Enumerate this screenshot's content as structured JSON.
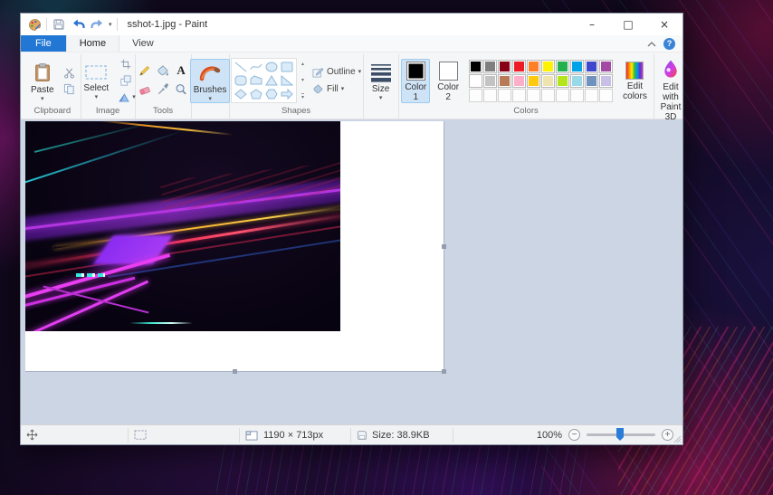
{
  "titlebar": {
    "title": "sshot-1.jpg - Paint",
    "minimize": "–",
    "maximize": "□",
    "close": "×"
  },
  "tabs": {
    "file": "File",
    "home": "Home",
    "view": "View"
  },
  "ribbon": {
    "clipboard": {
      "label": "Clipboard",
      "paste": "Paste"
    },
    "image": {
      "label": "Image",
      "select": "Select"
    },
    "tools": {
      "label": "Tools",
      "text_icon": "A"
    },
    "brushes": {
      "label": "Brushes"
    },
    "shapes": {
      "label": "Shapes",
      "outline": "Outline",
      "fill": "Fill"
    },
    "size": {
      "label": "Size"
    },
    "colors": {
      "label": "Colors",
      "color1_top": "Color",
      "color1_bottom": "1",
      "color2_top": "Color",
      "color2_bottom": "2",
      "edit_top": "Edit",
      "edit_bottom": "colors",
      "color1_value": "#000000",
      "color2_value": "#ffffff",
      "palette": [
        [
          "#000000",
          "#7f7f7f",
          "#880015",
          "#ed1c24",
          "#ff7f27",
          "#fff200",
          "#22b14c",
          "#00a2e8",
          "#3f48cc",
          "#a349a4"
        ],
        [
          "#ffffff",
          "#c3c3c3",
          "#b97a57",
          "#ffaec9",
          "#ffc90e",
          "#efe4b0",
          "#b5e61d",
          "#99d9ea",
          "#7092be",
          "#c8bfe7"
        ]
      ],
      "empty_slots": 10
    },
    "paint3d": {
      "line1": "Edit with",
      "line2": "Paint 3D"
    }
  },
  "statusbar": {
    "dimensions": "1190 × 713px",
    "file_size": "Size: 38.9KB",
    "zoom": "100%"
  },
  "icons": {
    "dropdown": "▾",
    "scroll_up": "▴",
    "scroll_down": "▾",
    "zoom_out": "−",
    "zoom_in": "+"
  },
  "accent_colors": {
    "file_tab_blue": "#2277d4",
    "selection_highlight": "#cfe3f7",
    "zoom_thumb_blue": "#2b7cd8"
  }
}
